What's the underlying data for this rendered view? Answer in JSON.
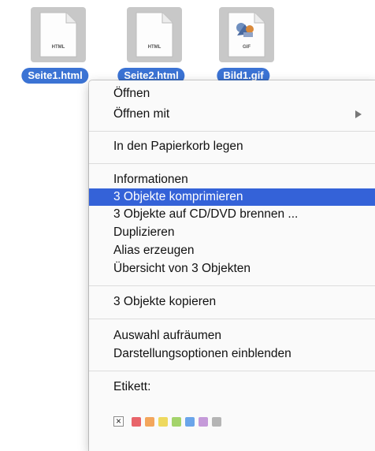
{
  "desktop": {
    "files": [
      {
        "name": "Seite1.html",
        "type_label": "HTML"
      },
      {
        "name": "Seite2.html",
        "type_label": "HTML"
      },
      {
        "name": "Bild1.gif",
        "type_label": "GIF"
      }
    ],
    "selection_color": "#3b73d4"
  },
  "context_menu": {
    "groups": [
      [
        "Öffnen",
        "Öffnen mit"
      ],
      [
        "In den Papierkorb legen"
      ],
      [
        "Informationen",
        "3 Objekte komprimieren",
        "3 Objekte auf CD/DVD brennen ...",
        "Duplizieren",
        "Alias erzeugen",
        "Übersicht von 3 Objekten"
      ],
      [
        "3 Objekte kopieren"
      ],
      [
        "Auswahl aufräumen",
        "Darstellungsoptionen einblenden"
      ]
    ],
    "highlighted_item": "3 Objekte komprimieren",
    "highlight_color": "#3462d8",
    "labels": {
      "title": "Etikett:",
      "none_symbol": "×",
      "colors": [
        {
          "name": "red",
          "hex": "#e8646a"
        },
        {
          "name": "orange",
          "hex": "#f3a65c"
        },
        {
          "name": "yellow",
          "hex": "#eed95e"
        },
        {
          "name": "green",
          "hex": "#a4d36b"
        },
        {
          "name": "blue",
          "hex": "#6aa5ea"
        },
        {
          "name": "purple",
          "hex": "#c59ad9"
        },
        {
          "name": "gray",
          "hex": "#b5b5b5"
        }
      ]
    }
  }
}
